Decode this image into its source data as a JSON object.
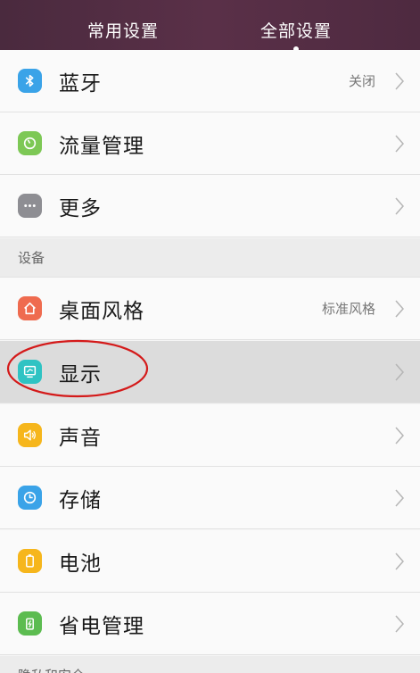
{
  "header": {
    "tabs": [
      {
        "label": "常用设置"
      },
      {
        "label": "全部设置",
        "active": true
      }
    ]
  },
  "rows": {
    "bluetooth": {
      "label": "蓝牙",
      "value": "关闭",
      "icon": "bluetooth-icon",
      "color": "#3aa3e8"
    },
    "data_usage": {
      "label": "流量管理",
      "icon": "data-usage-icon",
      "color": "#7dc855"
    },
    "more": {
      "label": "更多",
      "icon": "more-icon",
      "color": "#8e8e93"
    },
    "desktop_style": {
      "label": "桌面风格",
      "value": "标准风格",
      "icon": "home-icon",
      "color": "#ef6b4f"
    },
    "display": {
      "label": "显示",
      "icon": "display-icon",
      "color": "#2fc3c3"
    },
    "sound": {
      "label": "声音",
      "icon": "speaker-icon",
      "color": "#f6b61c"
    },
    "storage": {
      "label": "存储",
      "icon": "storage-icon",
      "color": "#3aa3e8"
    },
    "battery": {
      "label": "电池",
      "icon": "battery-icon",
      "color": "#f6b61c"
    },
    "power_saving": {
      "label": "省电管理",
      "icon": "power-saving-icon",
      "color": "#5cbc50"
    }
  },
  "sections": {
    "device": {
      "label": "设备"
    },
    "privacy": {
      "label": "隐私和安全"
    }
  },
  "annotation": {
    "color": "#d41a1a",
    "shape": "ellipse"
  }
}
